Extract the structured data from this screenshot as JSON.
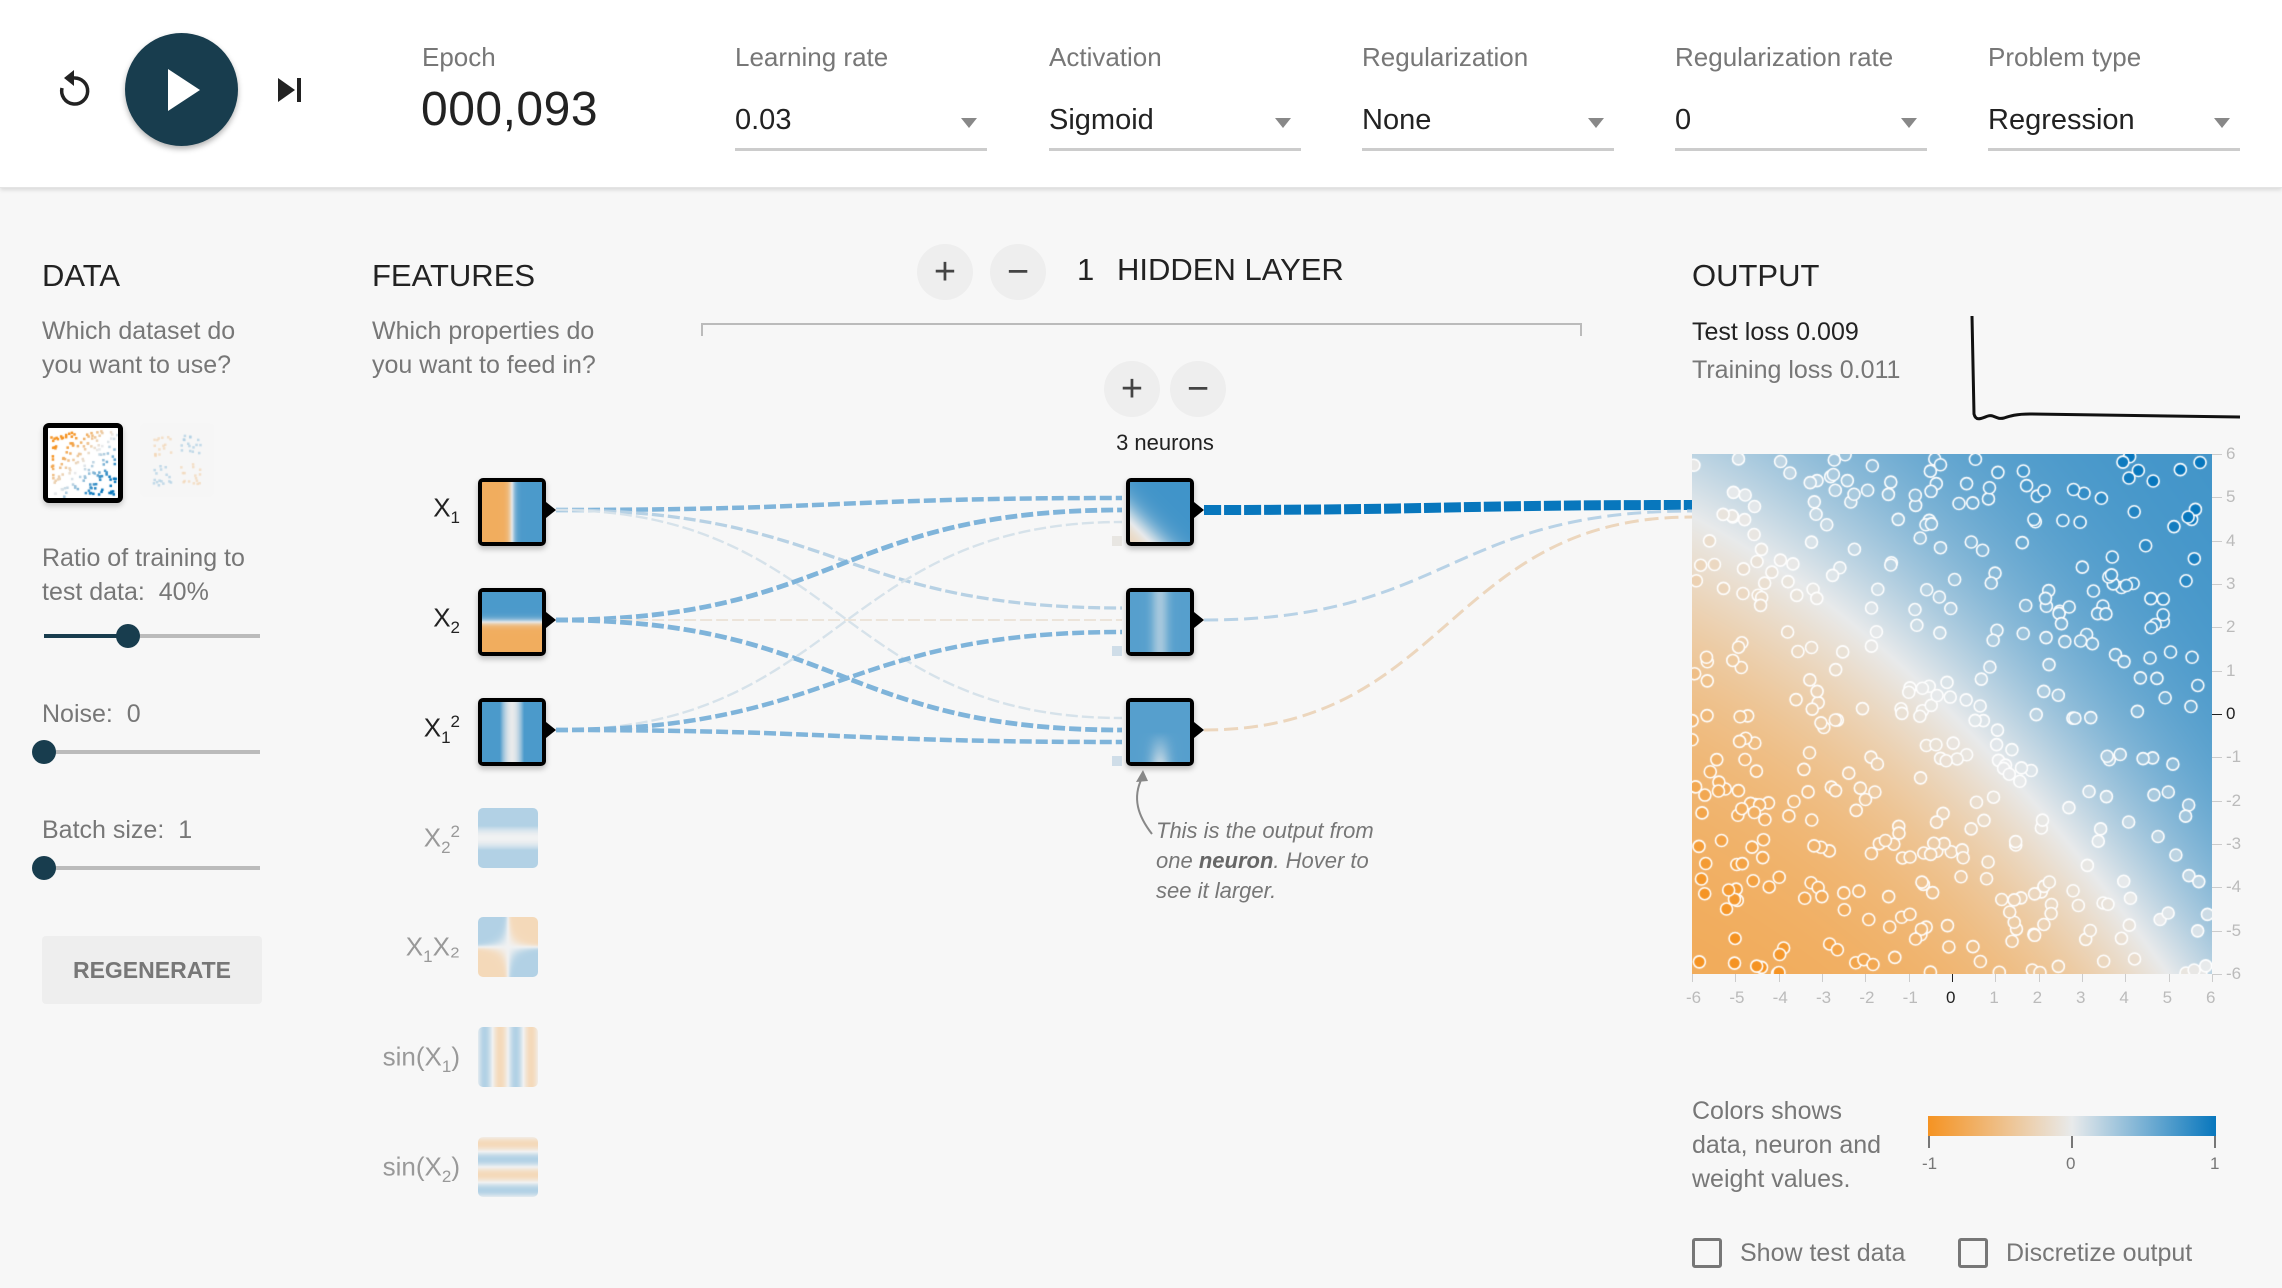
{
  "header": {
    "reset_icon": "reset-icon",
    "play_icon": "play-icon",
    "step_icon": "step-forward-icon",
    "epoch_label": "Epoch",
    "epoch_value": "000,093",
    "dropdowns": [
      {
        "label": "Learning rate",
        "value": "0.03"
      },
      {
        "label": "Activation",
        "value": "Sigmoid"
      },
      {
        "label": "Regularization",
        "value": "None"
      },
      {
        "label": "Regularization rate",
        "value": "0"
      },
      {
        "label": "Problem type",
        "value": "Regression"
      }
    ]
  },
  "data_panel": {
    "title": "DATA",
    "description": "Which dataset do you want to use?",
    "datasets": [
      {
        "name": "plane-regression",
        "selected": true
      },
      {
        "name": "multi-gaussian",
        "selected": false
      }
    ],
    "ratio_label": "Ratio of training to test data:",
    "ratio_value": "40%",
    "ratio_fraction": 0.4,
    "noise_label": "Noise:",
    "noise_value": "0",
    "noise_fraction": 0,
    "batch_label": "Batch size:",
    "batch_value": "1",
    "batch_fraction": 0,
    "regenerate_label": "REGENERATE"
  },
  "features_panel": {
    "title": "FEATURES",
    "description": "Which properties do you want to feed in?",
    "features": [
      {
        "id": "x1",
        "base": "X",
        "sub": "1",
        "sup": "",
        "pre": "",
        "post": "",
        "enabled": true
      },
      {
        "id": "x2",
        "base": "X",
        "sub": "2",
        "sup": "",
        "pre": "",
        "post": "",
        "enabled": true
      },
      {
        "id": "x1sq",
        "base": "X",
        "sub": "1",
        "sup": "2",
        "pre": "",
        "post": "",
        "enabled": true
      },
      {
        "id": "x2sq",
        "base": "X",
        "sub": "2",
        "sup": "2",
        "pre": "",
        "post": "",
        "enabled": false
      },
      {
        "id": "x1x2",
        "base": "X",
        "sub": "1",
        "sup": "",
        "pre": "",
        "post": "X₂",
        "enabled": false
      },
      {
        "id": "sinx1",
        "base": "X",
        "sub": "1",
        "sup": "",
        "pre": "sin(",
        "post": ")",
        "enabled": false
      },
      {
        "id": "sinx2",
        "base": "X",
        "sub": "2",
        "sup": "",
        "pre": "sin(",
        "post": ")",
        "enabled": false
      }
    ]
  },
  "network": {
    "layer_count": "1",
    "layer_title": "HIDDEN LAYER",
    "add_layer_icon": "plus-icon",
    "remove_layer_icon": "minus-icon",
    "neurons_label": "3 neurons",
    "annotation_pre": "This is the output from one ",
    "annotation_bold": "neuron",
    "annotation_post": ". Hover to see it larger."
  },
  "output_panel": {
    "title": "OUTPUT",
    "test_loss": "Test loss 0.009",
    "train_loss": "Training loss 0.011",
    "legend_text": "Colors shows data, neuron and weight values.",
    "legend_ticks": [
      "-1",
      "0",
      "1"
    ],
    "show_test_data_label": "Show test data",
    "show_test_data_checked": false,
    "discretize_label": "Discretize output",
    "discretize_checked": false
  },
  "colors": {
    "orange": "#f59322",
    "blue": "#0877bd",
    "neutral": "#e8eaeb",
    "play_button": "#183d4e"
  },
  "chart_data": {
    "type": "heatmap",
    "title": "Output",
    "xlabel": "",
    "ylabel": "",
    "xlim": [
      -6,
      6
    ],
    "ylim": [
      -6,
      6
    ],
    "x_ticks": [
      "-6",
      "-5",
      "-4",
      "-3",
      "-2",
      "-1",
      "0",
      "1",
      "2",
      "3",
      "4",
      "5",
      "6"
    ],
    "y_ticks": [
      "6",
      "5",
      "4",
      "3",
      "2",
      "1",
      "0",
      "-1",
      "-2",
      "-3",
      "-4",
      "-5",
      "-6"
    ],
    "description": "Regression output surface: orange (-1) lower-left to blue (+1) upper-right, with scattered training points colored by target value",
    "loss_curve": {
      "type": "line",
      "trend": "sharp drop then flat near 0.01"
    }
  }
}
